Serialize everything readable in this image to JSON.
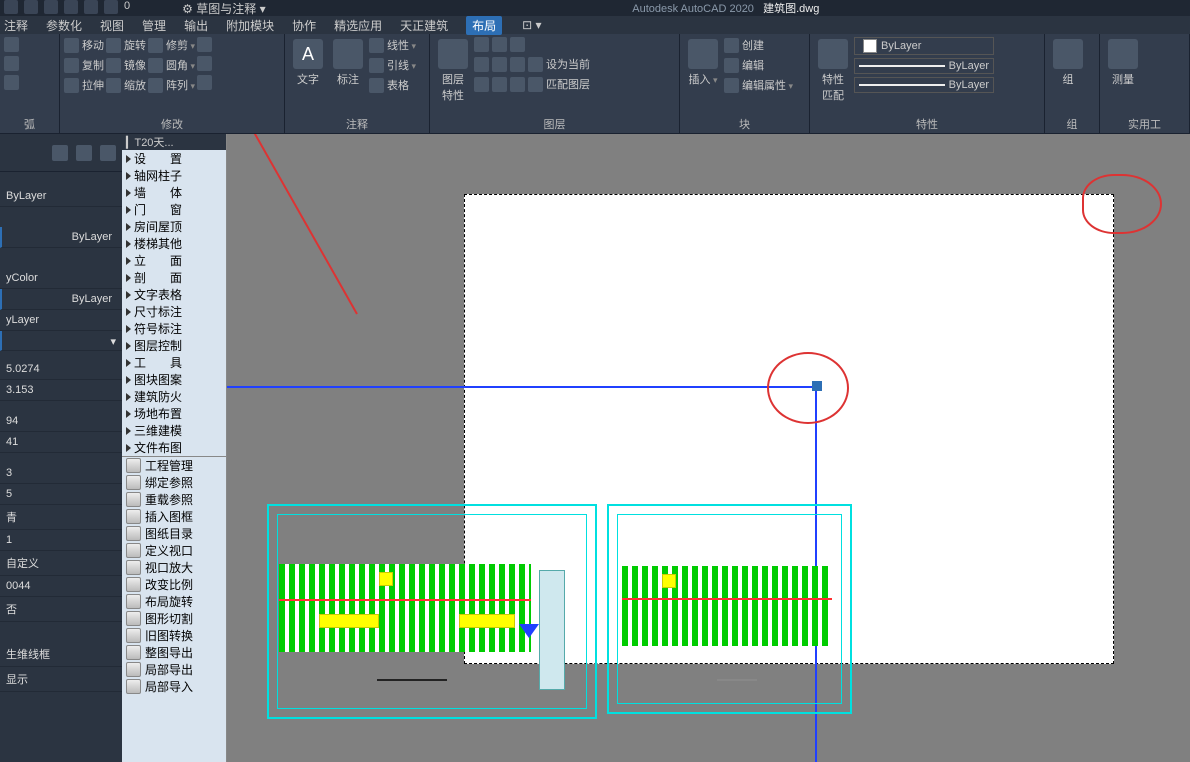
{
  "app": {
    "name": "Autodesk AutoCAD 2020",
    "file": "建筑图.dwg"
  },
  "qat_dropdown_value": "0",
  "ribbon_dd": "草图与注释",
  "menus": [
    "注释",
    "参数化",
    "视图",
    "管理",
    "输出",
    "附加模块",
    "协作",
    "精选应用",
    "天正建筑",
    "布局"
  ],
  "active_menu": "布局",
  "toolbox_label": "⊡ ▾",
  "ribbon": {
    "modify": {
      "title": "修改",
      "items": [
        "移动",
        "旋转",
        "修剪",
        "复制",
        "镜像",
        "圆角",
        "拉伸",
        "缩放",
        "阵列"
      ]
    },
    "annot": {
      "title": "注释",
      "text": "文字",
      "dim": "标注",
      "lines": [
        "线性",
        "引线",
        "表格"
      ]
    },
    "layer": {
      "title": "图层",
      "big": "图层\n特性",
      "items": [
        "设为当前",
        "匹配图层"
      ]
    },
    "block": {
      "title": "块",
      "big": "插入",
      "items": [
        "创建",
        "编辑",
        "编辑属性"
      ]
    },
    "props": {
      "title": "特性",
      "big": "特性\n匹配",
      "bylayer": "ByLayer"
    },
    "group": {
      "title": "组",
      "big": "组"
    },
    "measure": {
      "title": "测量",
      "part": "实用工"
    },
    "arc": {
      "title": "弧"
    }
  },
  "tree_header": "T20天...",
  "tree": [
    "设　　置",
    "轴网柱子",
    "墙　　体",
    "门　　窗",
    "房间屋顶",
    "楼梯其他",
    "立　　面",
    "剖　　面",
    "文字表格",
    "尺寸标注",
    "符号标注",
    "图层控制",
    "工　　具",
    "图块图案",
    "建筑防火",
    "场地布置",
    "三维建模",
    "文件布图"
  ],
  "tools": [
    "工程管理",
    "绑定参照",
    "重载参照",
    "插入图框",
    "图纸目录",
    "定义视口",
    "视口放大",
    "改变比例",
    "布局旋转",
    "图形切割",
    "旧图转换",
    "整图导出",
    "局部导出",
    "局部导入"
  ],
  "props_panel": {
    "layer": "ByLayer",
    "layer2": "ByLayer",
    "bycolor": "yColor",
    "bylayer3": "ByLayer",
    "yLayer": "yLayer",
    "x": "5.0274",
    "y": "3.153",
    "n1": "94",
    "n2": "41",
    "misc": [
      "3",
      "5",
      "青",
      "1",
      "自定义",
      "0044",
      "否"
    ],
    "wire": "生维线框",
    "disp": "显示"
  }
}
